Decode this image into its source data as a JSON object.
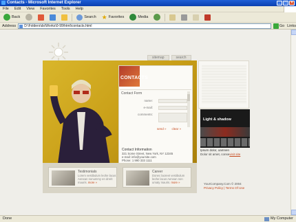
{
  "window": {
    "title": "Contacts - Microsoft Internet Explorer"
  },
  "menu": [
    "File",
    "Edit",
    "View",
    "Favorites",
    "Tools",
    "Help"
  ],
  "toolbar": {
    "back": "Back",
    "search": "Search",
    "favorites": "Favorites",
    "media": "Media"
  },
  "address": {
    "label": "Address",
    "value": "D:\\Folders\\ds\\Works\\0-99\\html\\contacts.html",
    "go": "Go",
    "links": "Links"
  },
  "site": {
    "nav": [
      "sitemap",
      "search"
    ],
    "contact_title": "CONTACTS",
    "form": {
      "title": "Contact Form",
      "fields": [
        "name:",
        "e-mail:",
        "comments:"
      ],
      "send": "send »",
      "clear": "clear »"
    },
    "info": {
      "heading": "Contact Information",
      "address": "321 Some Street, New York, NY 12345",
      "email": "e-mail: info@yoursite.com",
      "phone": "Phone: 1 990 333 1111",
      "fax": "Fax: 1 990 333 1111"
    },
    "promo": {
      "label": "Light & shadow"
    },
    "lorem": {
      "heading": "Ipsum dolor, oamnen",
      "text": "Dolor sit amet, conse",
      "link": "visit site"
    },
    "cards": [
      {
        "title": "Testimonials",
        "text": "Lorem vestibulum leohe lacus Aenean nonummy en drerit mauris.",
        "more": "more »"
      },
      {
        "title": "Career",
        "text": "Donec laoreet vestibulum leohe lacus Aenean non umaty mauris.",
        "more": "more »"
      }
    ],
    "footer": {
      "copy": "YourCompany.Com © 2004",
      "links": "Privacy Policy | Terms Of Use"
    }
  },
  "status": {
    "left": "Done",
    "zone": "My Computer"
  }
}
